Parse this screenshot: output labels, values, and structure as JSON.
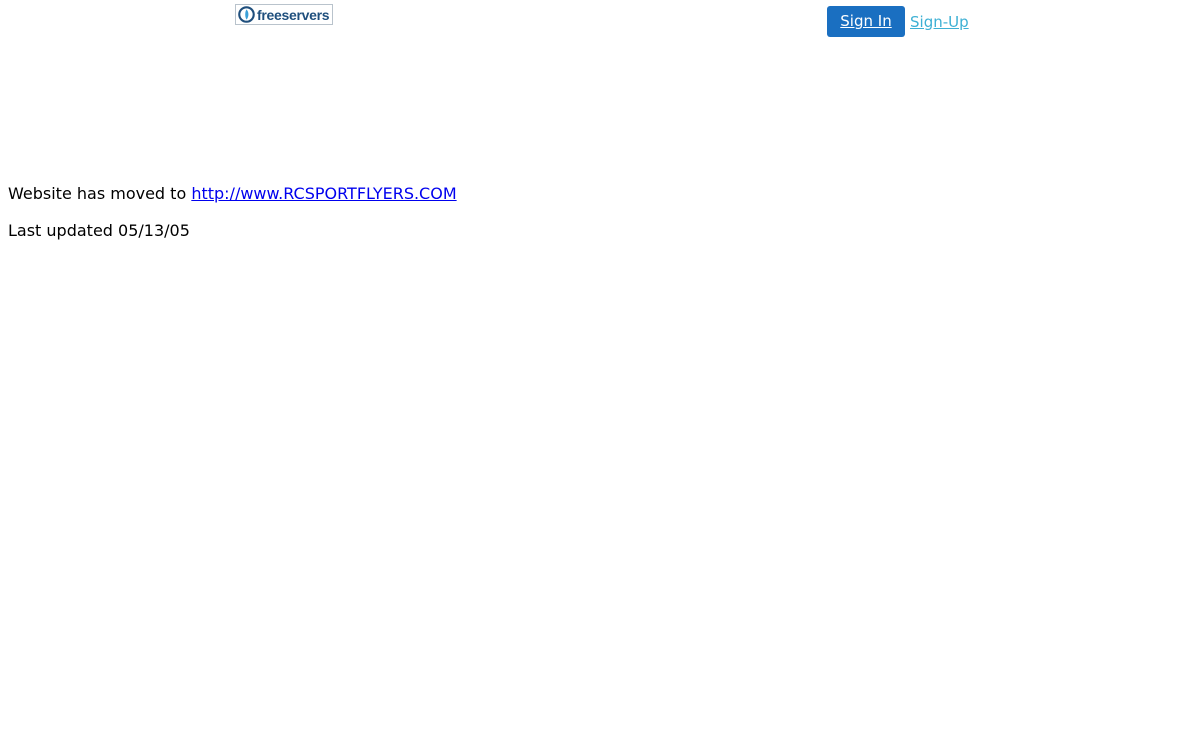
{
  "header": {
    "logo_text": "freeservers",
    "signin_label": "Sign In",
    "signup_label": "Sign-Up",
    "colors": {
      "signin_bg": "#1a6fc1",
      "signup_link": "#3db0d4",
      "logo_text": "#1f4f7d"
    }
  },
  "main": {
    "moved_text": "Website has moved to ",
    "moved_link": "http://www.RCSPORTFLYERS.COM",
    "last_updated": "Last updated 05/13/05"
  }
}
